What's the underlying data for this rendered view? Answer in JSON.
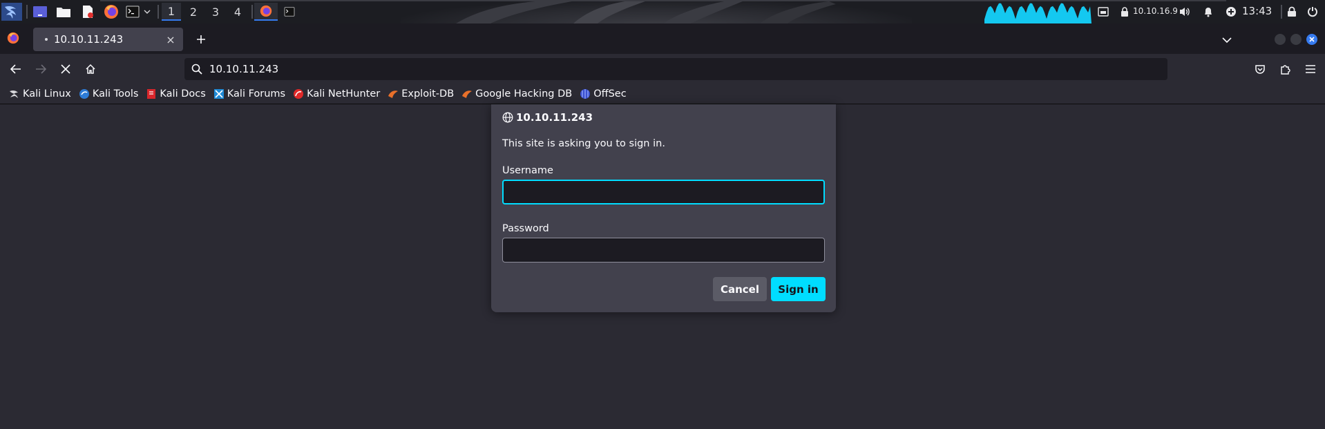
{
  "panel": {
    "workspaces": [
      "1",
      "2",
      "3",
      "4"
    ],
    "active_workspace": "1",
    "network_ip": "10.10.16.9",
    "clock": "13:43"
  },
  "tab": {
    "title": "10.10.11.243",
    "close_glyph": "×"
  },
  "navbar": {
    "url": "10.10.11.243"
  },
  "bookmarks": [
    {
      "label": "Kali Linux",
      "icon": "kali-dragon-icon"
    },
    {
      "label": "Kali Tools",
      "icon": "kali-tools-icon"
    },
    {
      "label": "Kali Docs",
      "icon": "kali-docs-icon"
    },
    {
      "label": "Kali Forums",
      "icon": "kali-forums-icon"
    },
    {
      "label": "Kali NetHunter",
      "icon": "nethunter-icon"
    },
    {
      "label": "Exploit-DB",
      "icon": "exploit-db-icon"
    },
    {
      "label": "Google Hacking DB",
      "icon": "ghdb-icon"
    },
    {
      "label": "OffSec",
      "icon": "offsec-icon"
    }
  ],
  "dialog": {
    "host": "10.10.11.243",
    "message": "This site is asking you to sign in.",
    "username_label": "Username",
    "username_value": "",
    "password_label": "Password",
    "password_value": "",
    "cancel_label": "Cancel",
    "signin_label": "Sign in"
  },
  "colors": {
    "accent": "#00ddff",
    "panel_bg": "#1c1d22",
    "toolbar_bg": "#2b2a33",
    "tab_bg": "#42414d",
    "workspace_indicator": "#367bf0",
    "window_close": "#367bf0"
  }
}
